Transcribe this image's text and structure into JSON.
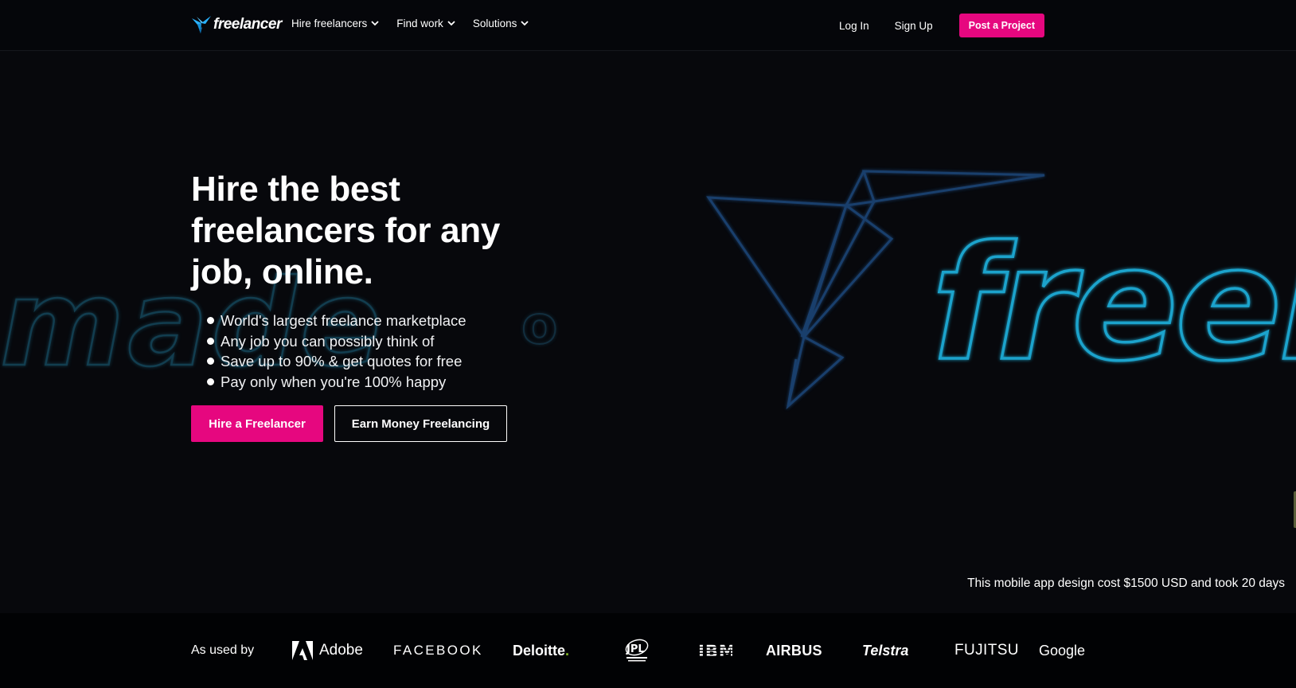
{
  "brand": {
    "name": "freelancer",
    "accent_color": "#e6077f",
    "logo_icon_color": "#29b2fe"
  },
  "nav": {
    "items": [
      {
        "label": "Hire freelancers",
        "icon": "chevron-down-icon"
      },
      {
        "label": "Find work",
        "icon": "chevron-down-icon"
      },
      {
        "label": "Solutions",
        "icon": "chevron-down-icon"
      }
    ],
    "login_label": "Log In",
    "signup_label": "Sign Up",
    "post_project_label": "Post a Project"
  },
  "hero": {
    "headline_lines": [
      "Hire the best",
      "freelancers for any",
      "job, online."
    ],
    "bullets": [
      "World's largest freelance marketplace",
      "Any job you can possibly think of",
      "Save up to 90% & get quotes for free",
      "Pay only when you're 100% happy"
    ],
    "primary_cta": "Hire a Freelancer",
    "secondary_cta": "Earn Money Freelancing",
    "caption": "This mobile app design cost $1500 USD and took 20 days",
    "background_colors": {
      "neon_cyan": "#1a9fc8",
      "neon_blue": "#1d3f66"
    }
  },
  "used_by": {
    "label": "As used by",
    "logos": [
      {
        "name": "Adobe",
        "icon": "adobe-logo-icon"
      },
      {
        "name": "FACEBOOK"
      },
      {
        "name": "Deloitte",
        "suffix": "."
      },
      {
        "name": "NASA",
        "icon": "nasa-jpl-logo-icon"
      },
      {
        "name": "IBM"
      },
      {
        "name": "AIRBUS"
      },
      {
        "name": "Telstra"
      },
      {
        "name": "FUJITSU"
      },
      {
        "name": "Google"
      }
    ]
  }
}
